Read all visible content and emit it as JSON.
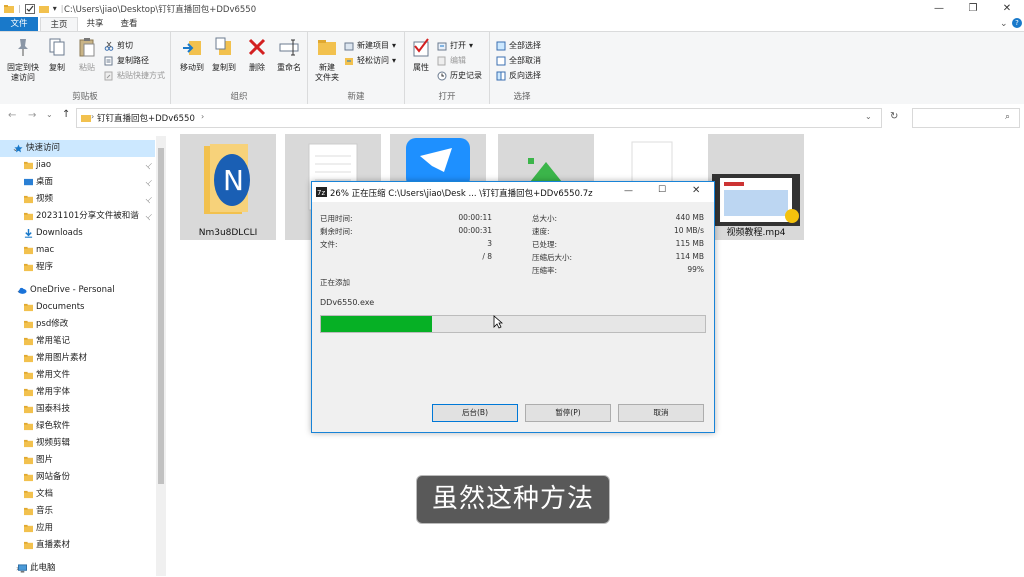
{
  "window": {
    "title": "C:\\Users\\jiao\\Desktop\\钉钉直播回包+DDv6550"
  },
  "tabs": [
    {
      "label": "文件"
    },
    {
      "label": "主页"
    },
    {
      "label": "共享"
    },
    {
      "label": "查看"
    }
  ],
  "ribbon": {
    "clipboard": {
      "pin_label": "固定到快\n速访问",
      "copy_label": "复制",
      "paste_label": "粘贴",
      "cut_label": "剪切",
      "copy_path_label": "复制路径",
      "paste_shortcut_label": "粘贴快捷方式",
      "group_label": "剪贴板"
    },
    "organize": {
      "move_label": "移动到",
      "copyto_label": "复制到",
      "delete_label": "删除",
      "rename_label": "重命名",
      "group_label": "组织"
    },
    "new": {
      "newfolder_label": "新建\n文件夹",
      "newitem_label": "新建项目",
      "easyaccess_label": "轻松访问",
      "group_label": "新建"
    },
    "open": {
      "properties_label": "属性",
      "open_label": "打开",
      "edit_label": "编辑",
      "history_label": "历史记录",
      "group_label": "打开"
    },
    "select": {
      "selectall_label": "全部选择",
      "selectnone_label": "全部取消",
      "invert_label": "反向选择",
      "group_label": "选择"
    }
  },
  "address": {
    "path": "钉钉直播回包+DDv6550"
  },
  "nav": {
    "items": [
      {
        "label": "快速访问",
        "pinned": false
      },
      {
        "label": "jiao",
        "pinned": true
      },
      {
        "label": "桌面",
        "pinned": true
      },
      {
        "label": "视频",
        "pinned": true
      },
      {
        "label": "20231101分享文件被和谐",
        "pinned": true
      },
      {
        "label": "Downloads",
        "pinned": false
      },
      {
        "label": "mac",
        "pinned": false
      },
      {
        "label": "程序",
        "pinned": false
      },
      {
        "label": "OneDrive - Personal",
        "pinned": false
      },
      {
        "label": "Documents",
        "pinned": false
      },
      {
        "label": "psd修改",
        "pinned": false
      },
      {
        "label": "常用笔记",
        "pinned": false
      },
      {
        "label": "常用图片素材",
        "pinned": false
      },
      {
        "label": "常用文件",
        "pinned": false
      },
      {
        "label": "常用字体",
        "pinned": false
      },
      {
        "label": "国泰科技",
        "pinned": false
      },
      {
        "label": "绿色软件",
        "pinned": false
      },
      {
        "label": "视频剪辑",
        "pinned": false
      },
      {
        "label": "图片",
        "pinned": false
      },
      {
        "label": "网站备份",
        "pinned": false
      },
      {
        "label": "文档",
        "pinned": false
      },
      {
        "label": "音乐",
        "pinned": false
      },
      {
        "label": "应用",
        "pinned": false
      },
      {
        "label": "直播素材",
        "pinned": false
      },
      {
        "label": "此电脑",
        "pinned": false
      }
    ],
    "pin_glyph": "📌"
  },
  "files": [
    {
      "name": "Nm3u8DLCLI"
    },
    {
      "name": ""
    },
    {
      "name": ""
    },
    {
      "name": ""
    },
    {
      "name": ""
    },
    {
      "name": "视频教程.mp4"
    }
  ],
  "dialog": {
    "title": "26% 正在压缩 C:\\Users\\jiao\\Desk ... \\钉钉直播回包+DDv6550.7z",
    "elapsed_label": "已用时间:",
    "elapsed_value": "00:00:11",
    "remaining_label": "剩余时间:",
    "remaining_value": "00:00:31",
    "files_label": "文件:",
    "files_value": "3",
    "files_total": "/ 8",
    "total_label": "总大小:",
    "total_value": "440 MB",
    "speed_label": "速度:",
    "speed_value": "10 MB/s",
    "processed_label": "已处理:",
    "processed_value": "115 MB",
    "compressed_label": "压缩后大小:",
    "compressed_value": "114 MB",
    "ratio_label": "压缩率:",
    "ratio_value": "99%",
    "adding_label": "正在添加",
    "current_file": "DDv6550.exe",
    "progress_percent": 29,
    "bg_button": "后台(B)",
    "pause_button": "暂停(P)",
    "cancel_button": "取消"
  },
  "subtitle": "虽然这种方法",
  "colors": {
    "accent": "#1979ca",
    "progress": "#06b025",
    "folder": "#f2c14e"
  }
}
